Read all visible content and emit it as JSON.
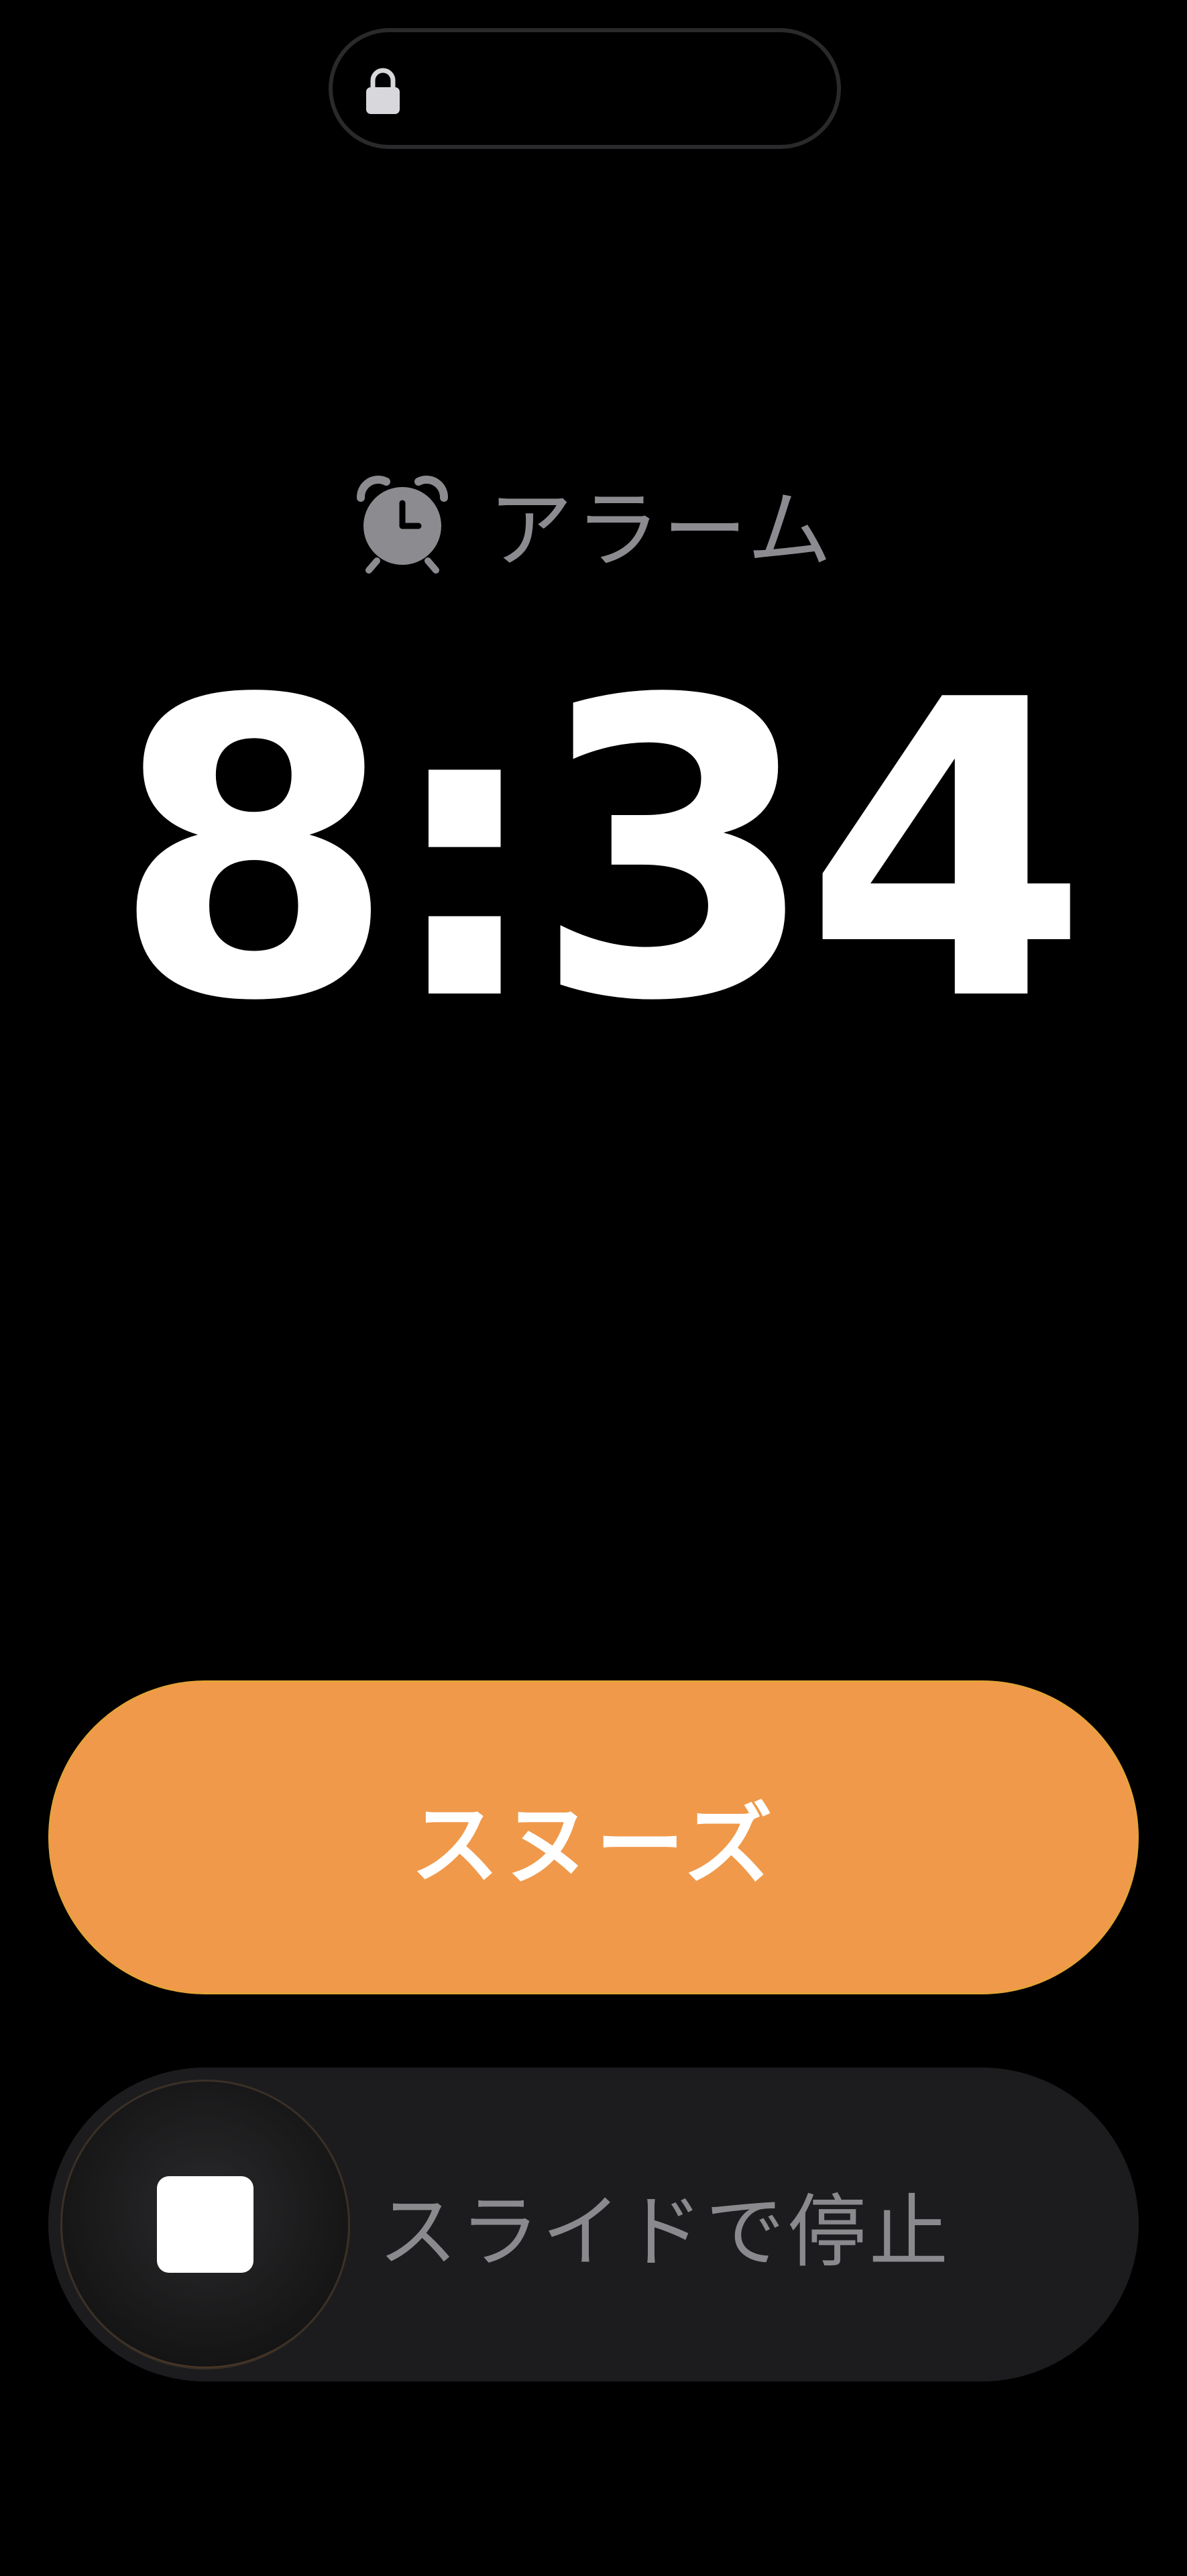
{
  "status": {
    "lock_icon": "lock-icon"
  },
  "alarm": {
    "icon": "alarm-clock-icon",
    "label": "アラーム"
  },
  "time": {
    "value": "8:34"
  },
  "snooze": {
    "label": "スヌーズ",
    "color": "#f0994a"
  },
  "stop": {
    "label": "スライドで停止",
    "knob_icon": "stop-square-icon"
  }
}
